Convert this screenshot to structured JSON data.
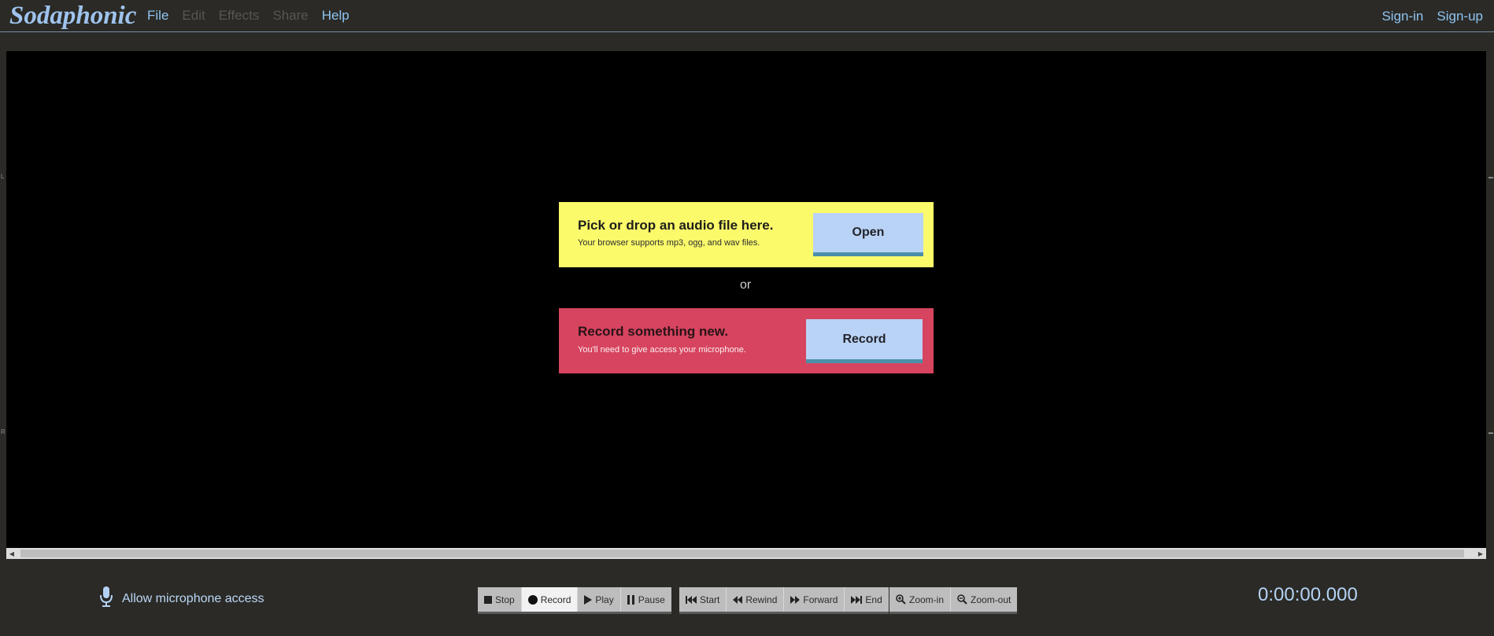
{
  "app": {
    "logo": "Sodaphonic"
  },
  "menu": [
    {
      "label": "File",
      "enabled": true
    },
    {
      "label": "Edit",
      "enabled": false
    },
    {
      "label": "Effects",
      "enabled": false
    },
    {
      "label": "Share",
      "enabled": false
    },
    {
      "label": "Help",
      "enabled": true
    }
  ],
  "auth": {
    "signin": "Sign-in",
    "signup": "Sign-up"
  },
  "channels": {
    "left": "L",
    "right": "R"
  },
  "open_card": {
    "title": "Pick or drop an audio file here.",
    "subtitle": "Your browser supports mp3, ogg, and wav files.",
    "button": "Open"
  },
  "separator": "or",
  "record_card": {
    "title": "Record something new.",
    "subtitle": "You'll need to give access your microphone.",
    "button": "Record"
  },
  "mic": {
    "label": "Allow microphone access"
  },
  "transport": {
    "stop": "Stop",
    "record": "Record",
    "play": "Play",
    "pause": "Pause"
  },
  "seek": {
    "start": "Start",
    "rewind": "Rewind",
    "forward": "Forward",
    "end": "End"
  },
  "zoom": {
    "zoom_in": "Zoom-in",
    "zoom_out": "Zoom-out"
  },
  "timer": "0:00:00.000",
  "colors": {
    "accent": "#8ec4f2",
    "open_card": "#fbfa6a",
    "record_card": "#d6445f",
    "button": "#b9d3f6"
  }
}
